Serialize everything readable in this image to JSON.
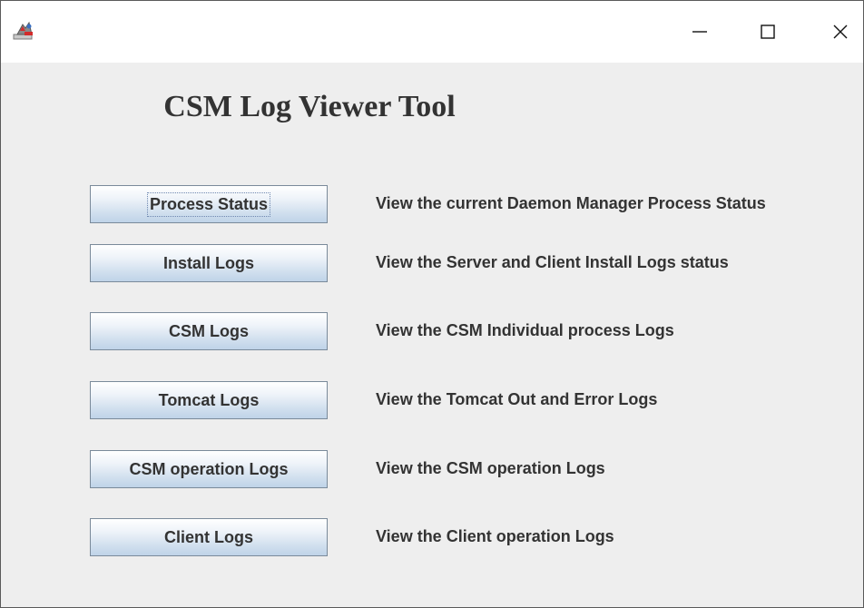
{
  "window": {
    "title": "",
    "controls": {
      "minimize_icon": "minimize-icon",
      "maximize_icon": "maximize-icon",
      "close_icon": "close-icon"
    }
  },
  "main": {
    "heading": "CSM Log Viewer Tool",
    "rows": [
      {
        "button": "Process Status",
        "description": "View the current Daemon Manager Process Status",
        "focused": true
      },
      {
        "button": "Install Logs",
        "description": "View the Server and Client Install Logs status",
        "focused": false
      },
      {
        "button": "CSM Logs",
        "description": "View the CSM Individual process Logs",
        "focused": false
      },
      {
        "button": "Tomcat Logs",
        "description": "View the Tomcat Out and Error Logs",
        "focused": false
      },
      {
        "button": "CSM operation Logs",
        "description": "View the CSM operation Logs",
        "focused": false
      },
      {
        "button": "Client Logs",
        "description": "View the Client operation Logs",
        "focused": false
      }
    ]
  },
  "colors": {
    "background": "#eeeeee",
    "text": "#333333",
    "button_top": "#ffffff",
    "button_bottom": "#bfd3e8",
    "button_border": "#7a8a9a"
  }
}
